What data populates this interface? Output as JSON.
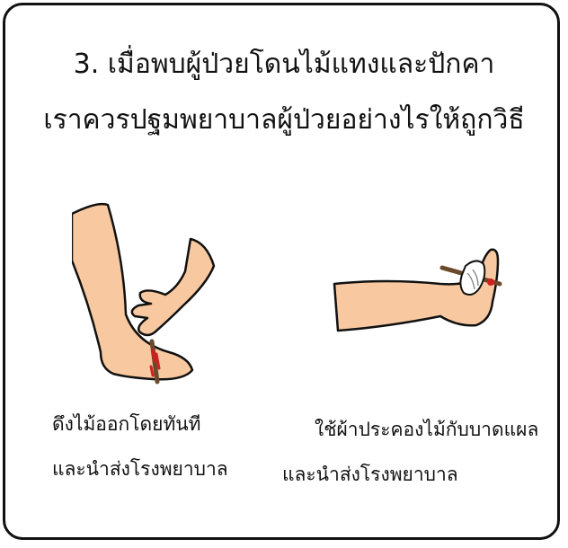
{
  "question": {
    "line1": "3. เมื่อพบผู้ป่วยโดนไม้แทงและปักคา",
    "line2": "เราควรปฐมพยาบาลผู้ป่วยอย่างไรให้ถูกวิธี"
  },
  "options": [
    {
      "line1": "ดึงไม้ออกโดยทันที",
      "line2": "และนำส่งโรงพยาบาล"
    },
    {
      "line1": "ใช้ผ้าประคองไม้กับบาดแผล",
      "line2": "และนำส่งโรงพยาบาล"
    }
  ],
  "colors": {
    "skin": "#f8c9a0",
    "outline": "#111111",
    "blood": "#d21f1f",
    "stick": "#6b4a2b"
  }
}
